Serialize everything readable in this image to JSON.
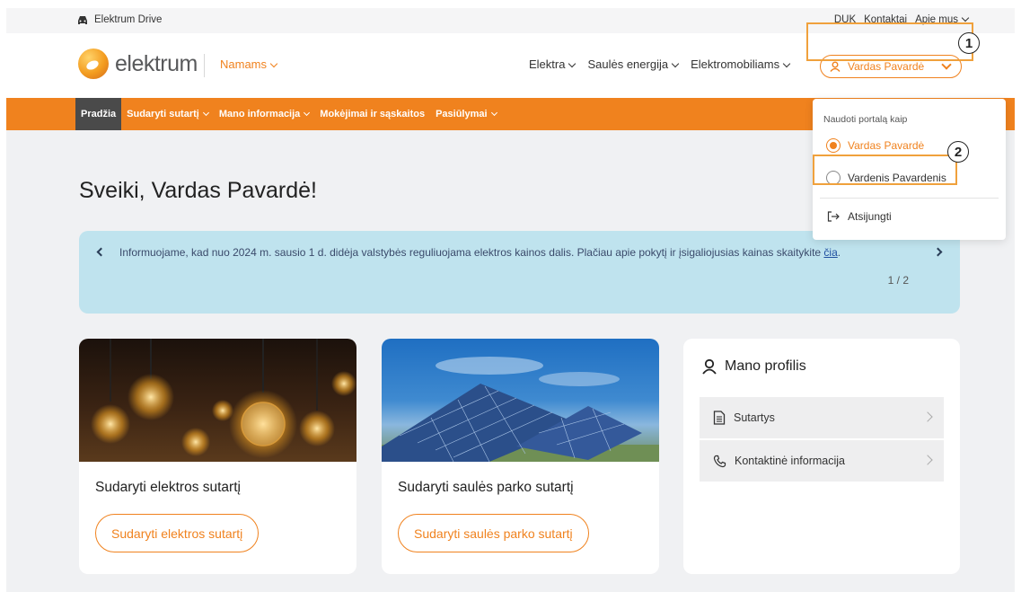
{
  "utility_bar": {
    "drive_label": "Elektrum Drive",
    "links": [
      "DUK",
      "Kontaktai",
      "Apie mus"
    ]
  },
  "header": {
    "logo_text": "elektrum",
    "segment": "Namams",
    "nav": [
      "Elektra",
      "Saulės energija",
      "Elektromobiliams"
    ],
    "user_button": "Vardas Pavardė"
  },
  "orange_nav": {
    "items": [
      "Pradžia",
      "Sudaryti sutartį",
      "Mano informacija",
      "Mokėjimai ir sąskaitos",
      "Pasiūlymai"
    ]
  },
  "greeting": "Sveiki, Vardas Pavardė!",
  "banner": {
    "text": "Informuojame, kad nuo 2024 m. sausio 1 d. didėja valstybės reguliuojama elektros kainos dalis. Plačiau apie pokytį ir įsigaliojusias kainas skaitykite",
    "link": "čia",
    "trailing": ".",
    "pager": "1 / 2"
  },
  "cards": [
    {
      "title": "Sudaryti elektros sutartį",
      "button": "Sudaryti elektros sutartį"
    },
    {
      "title": "Sudaryti saulės parko sutartį",
      "button": "Sudaryti saulės parko sutartį"
    }
  ],
  "profile": {
    "title": "Mano profilis",
    "items": [
      "Sutartys",
      "Kontaktinė informacija"
    ]
  },
  "dropdown": {
    "heading": "Naudoti portalą kaip",
    "options": [
      "Vardas Pavardė",
      "Vardenis Pavardenis"
    ],
    "selected": "Vardas Pavardė",
    "logout": "Atsijungti"
  },
  "annotations": [
    "1",
    "2"
  ],
  "colors": {
    "accent": "#f0821e",
    "banner_bg": "#bfe3ee",
    "active_nav": "#4a4a4a",
    "highlight": "#f0a13c"
  }
}
